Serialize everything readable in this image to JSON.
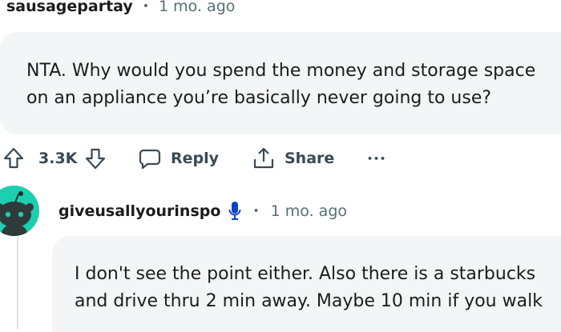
{
  "comment1": {
    "username": "sausagepartay",
    "separator": "•",
    "time": "1 mo. ago",
    "body_lines": [
      "NTA. Why would you spend the money and storage space",
      "on an appliance you’re basically never going to use?"
    ],
    "actions": {
      "vote_count": "3.3K",
      "reply_label": "Reply",
      "share_label": "Share",
      "more_label": "•••"
    }
  },
  "comment2": {
    "username": "giveusallyourinspo",
    "separator": "•",
    "time": "1 mo. ago",
    "body_lines": [
      "I don't see the point either. Also there is a starbucks",
      "and drive thru 2 min away. Maybe 10 min if you walk"
    ],
    "badge_icon": "microphone-icon",
    "avatar_icon": "snoo-avatar-icon"
  },
  "colors": {
    "bubble_bg": "#f3f5f7",
    "meta_text": "#576f76",
    "action_text": "#3a4a52",
    "avatar_bg": "#1ccfb0",
    "mic_badge": "#0a45c7"
  }
}
